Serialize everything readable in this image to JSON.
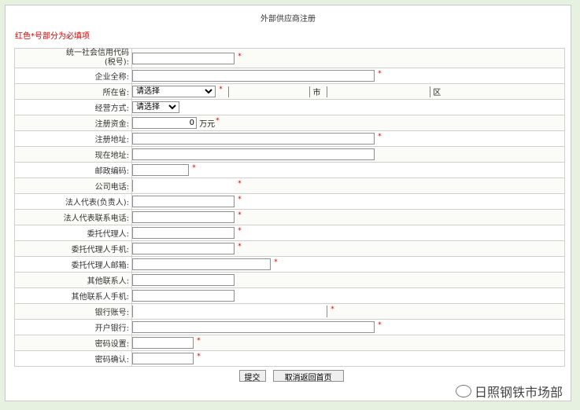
{
  "page": {
    "title": "外部供应商注册",
    "note": "红色*号部分为必填项",
    "required_mark": "*"
  },
  "form": {
    "credit_code": {
      "label_line1": "统一社会信用代码",
      "label_line2": "(税号):",
      "value": ""
    },
    "company_name": {
      "label": "企业全称:",
      "value": ""
    },
    "location": {
      "label": "所在省:",
      "province_select": "请选择",
      "city_suffix": "市",
      "district_suffix": "区"
    },
    "business_mode": {
      "label": "经营方式:",
      "select": "请选择"
    },
    "registered_capital": {
      "label": "注册资金:",
      "value": "0",
      "unit": "万元"
    },
    "registered_address": {
      "label": "注册地址:",
      "value": ""
    },
    "current_address": {
      "label": "现在地址:",
      "value": ""
    },
    "postal_code": {
      "label": "邮政编码:",
      "value": ""
    },
    "company_phone": {
      "label": "公司电话:",
      "value": ""
    },
    "legal_rep": {
      "label": "法人代表(负责人):",
      "value": ""
    },
    "legal_rep_phone": {
      "label": "法人代表联系电话:",
      "value": ""
    },
    "agent": {
      "label": "委托代理人:",
      "value": ""
    },
    "agent_mobile": {
      "label": "委托代理人手机:",
      "value": ""
    },
    "agent_email": {
      "label": "委托代理人邮箱:",
      "value": ""
    },
    "other_contact": {
      "label": "其他联系人:",
      "value": ""
    },
    "other_contact_mobile": {
      "label": "其他联系人手机:",
      "value": ""
    },
    "bank_account": {
      "label": "银行账号:",
      "value": ""
    },
    "bank_name": {
      "label": "开户银行:",
      "value": ""
    },
    "password": {
      "label": "密码设置:",
      "value": ""
    },
    "password_confirm": {
      "label": "密码确认:",
      "value": ""
    }
  },
  "buttons": {
    "submit": "提交",
    "cancel": "取消返回首页"
  },
  "watermark": {
    "text": "日照钢铁市场部"
  }
}
